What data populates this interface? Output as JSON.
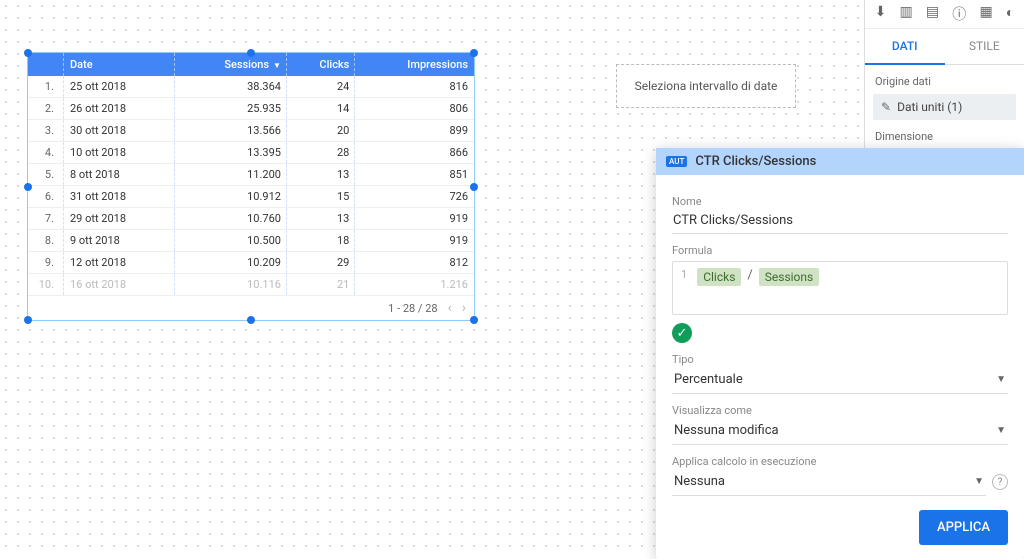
{
  "tabs": {
    "data": "DATI",
    "style": "STILE"
  },
  "sidebar": {
    "origin_label": "Origine dati",
    "source_name": "Dati uniti (1)",
    "dimension_label": "Dimensione"
  },
  "date_chip": "Seleziona intervallo di date",
  "table": {
    "headers": {
      "date": "Date",
      "sessions": "Sessions",
      "clicks": "Clicks",
      "impressions": "Impressions"
    },
    "rows": [
      {
        "idx": "1.",
        "date": "25 ott 2018",
        "sessions": "38.364",
        "clicks": "24",
        "impressions": "816"
      },
      {
        "idx": "2.",
        "date": "26 ott 2018",
        "sessions": "25.935",
        "clicks": "14",
        "impressions": "806"
      },
      {
        "idx": "3.",
        "date": "30 ott 2018",
        "sessions": "13.566",
        "clicks": "20",
        "impressions": "899"
      },
      {
        "idx": "4.",
        "date": "10 ott 2018",
        "sessions": "13.395",
        "clicks": "28",
        "impressions": "866"
      },
      {
        "idx": "5.",
        "date": "8 ott 2018",
        "sessions": "11.200",
        "clicks": "13",
        "impressions": "851"
      },
      {
        "idx": "6.",
        "date": "31 ott 2018",
        "sessions": "10.912",
        "clicks": "15",
        "impressions": "726"
      },
      {
        "idx": "7.",
        "date": "29 ott 2018",
        "sessions": "10.760",
        "clicks": "13",
        "impressions": "919"
      },
      {
        "idx": "8.",
        "date": "9 ott 2018",
        "sessions": "10.500",
        "clicks": "18",
        "impressions": "919"
      },
      {
        "idx": "9.",
        "date": "12 ott 2018",
        "sessions": "10.209",
        "clicks": "29",
        "impressions": "812"
      },
      {
        "idx": "10.",
        "date": "16 ott 2018",
        "sessions": "10.116",
        "clicks": "21",
        "impressions": "1.216"
      }
    ],
    "pagination": "1 - 28 / 28"
  },
  "calc": {
    "title": "CTR Clicks/Sessions",
    "name_label": "Nome",
    "name_value": "CTR Clicks/Sessions",
    "formula_label": "Formula",
    "formula_tokens": {
      "a": "Clicks",
      "op": "/",
      "b": "Sessions"
    },
    "type_label": "Tipo",
    "type_value": "Percentuale",
    "display_label": "Visualizza come",
    "display_value": "Nessuna modifica",
    "running_label": "Applica calcolo in esecuzione",
    "running_value": "Nessuna",
    "apply": "APPLICA",
    "aut_badge": "AUT"
  }
}
